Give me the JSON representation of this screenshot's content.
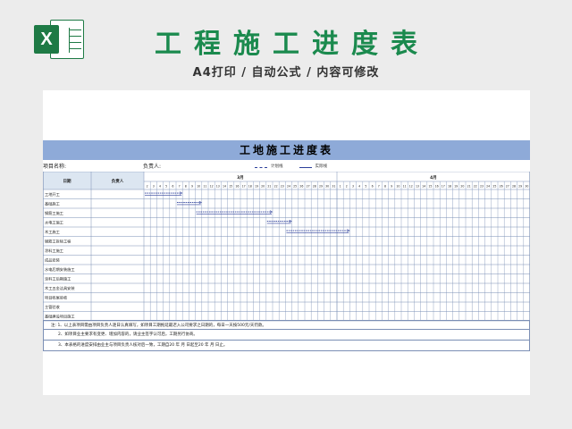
{
  "banner": {
    "logo_letter": "X",
    "title": "工程施工进度表",
    "subtitle": "A4打印 / 自动公式 / 内容可修改"
  },
  "sheet": {
    "title": "工地施工进度表",
    "project_label": "项目名称:",
    "owner_label": "负责人:",
    "legend_plan": "计划线",
    "legend_actual": "实际线",
    "col_item": "日期",
    "col_owner": "负责人",
    "month1": "3月",
    "month2": "4月",
    "days_month1": [
      "2",
      "3",
      "4",
      "5",
      "6",
      "7",
      "8",
      "9",
      "10",
      "11",
      "12",
      "13",
      "14",
      "15",
      "16",
      "17",
      "18",
      "19",
      "20",
      "21",
      "22",
      "23",
      "24",
      "25",
      "26",
      "27",
      "28",
      "29",
      "30",
      "31"
    ],
    "days_month2": [
      "1",
      "2",
      "3",
      "4",
      "5",
      "6",
      "7",
      "8",
      "9",
      "10",
      "11",
      "12",
      "13",
      "14",
      "15",
      "16",
      "17",
      "18",
      "19",
      "20",
      "21",
      "22",
      "23",
      "24",
      "25",
      "26",
      "27",
      "28",
      "29",
      "30"
    ],
    "tasks": [
      {
        "name": "工地开工",
        "start": 0,
        "end": 6
      },
      {
        "name": "基础施工",
        "start": 5,
        "end": 9
      },
      {
        "name": "钢筋工施工",
        "start": 8,
        "end": 20
      },
      {
        "name": "水电工施工",
        "start": 19,
        "end": 23
      },
      {
        "name": "木工施工",
        "start": 22,
        "end": 32
      },
      {
        "name": "钢筋工拆除工程",
        "start": null,
        "end": null
      },
      {
        "name": "涂料工施工",
        "start": null,
        "end": null
      },
      {
        "name": "成品安装",
        "start": null,
        "end": null
      },
      {
        "name": "水电后期安装施工",
        "start": null,
        "end": null
      },
      {
        "name": "涂料工后期施工",
        "start": null,
        "end": null
      },
      {
        "name": "木工五金洁具安装",
        "start": null,
        "end": null
      },
      {
        "name": "项目收尾验收",
        "start": null,
        "end": null
      },
      {
        "name": "主管验收",
        "start": null,
        "end": null
      },
      {
        "name": "基础建设项目施工",
        "start": null,
        "end": null
      }
    ],
    "notes": [
      "注: 1、以上表项目需由项目负责人逐日认真填写，如项目工期拖延最迟入公司要求之日期的，每日一天按500元/天罚款。",
      "2、如项目业主要求有变更、增加内容的，请业主签字认可后，工期另行协商。",
      "3、本表格的进度安排由业主与项目负责人核对后一致，工期自20    年    月    日起至20    年    月    日止。"
    ]
  },
  "colors": {
    "brand_green": "#1b8a4e",
    "title_bar": "#8eaad8",
    "header_fill": "#dce6f1",
    "grid_line": "#7b8fb5",
    "plan_line": "#2c3f9a"
  }
}
